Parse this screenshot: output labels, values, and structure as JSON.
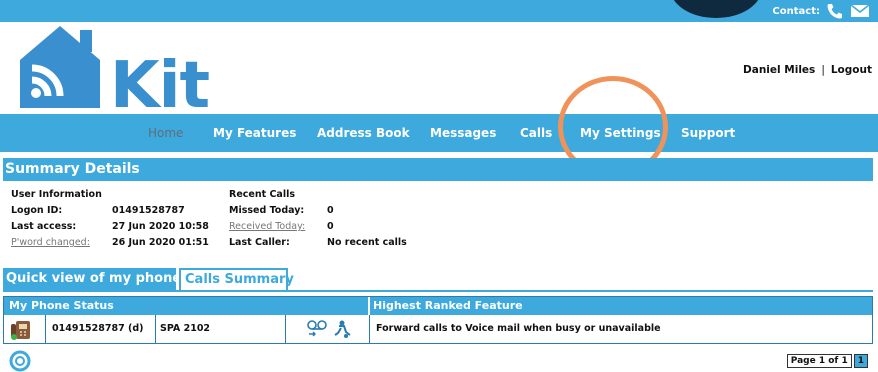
{
  "header": {
    "contact_label": "Contact:",
    "logo_text": "Kit",
    "user_name": "Daniel Miles",
    "separator": "|",
    "logout_label": "Logout"
  },
  "nav": {
    "items": [
      {
        "label": "Home"
      },
      {
        "label": "My Features"
      },
      {
        "label": "Address Book"
      },
      {
        "label": "Messages"
      },
      {
        "label": "Calls"
      },
      {
        "label": "My Settings"
      },
      {
        "label": "Support"
      }
    ]
  },
  "summary": {
    "title": "Summary Details",
    "user_info": {
      "heading": "User Information",
      "logon_label": "Logon ID:",
      "logon_value": "01491528787",
      "last_access_label": "Last access:",
      "last_access_value": "27 Jun 2020 10:58",
      "pword_label": "P'word changed:",
      "pword_value": "26 Jun 2020 01:51"
    },
    "recent_calls": {
      "heading": "Recent Calls",
      "missed_label": "Missed Today:",
      "missed_value": "0",
      "received_label": "Received Today:",
      "received_value": "0",
      "last_caller_label": "Last Caller:",
      "last_caller_value": "No recent calls"
    }
  },
  "tabs": {
    "quick_view": "Quick view of my phones",
    "calls_summary": "Calls Summary"
  },
  "phone_table": {
    "col_status": "My Phone Status",
    "col_feature": "Highest Ranked Feature",
    "rows": [
      {
        "number": "01491528787 (d)",
        "model": "SPA 2102",
        "feature": "Forward calls to Voice mail when busy or unavailable"
      }
    ]
  },
  "pager": {
    "page_of": "Page 1 of 1",
    "page_number": "1"
  },
  "colors": {
    "brand_blue": "#3ea9dd",
    "highlight_orange": "#f0935a",
    "logo_blue": "#3a8fcf"
  }
}
